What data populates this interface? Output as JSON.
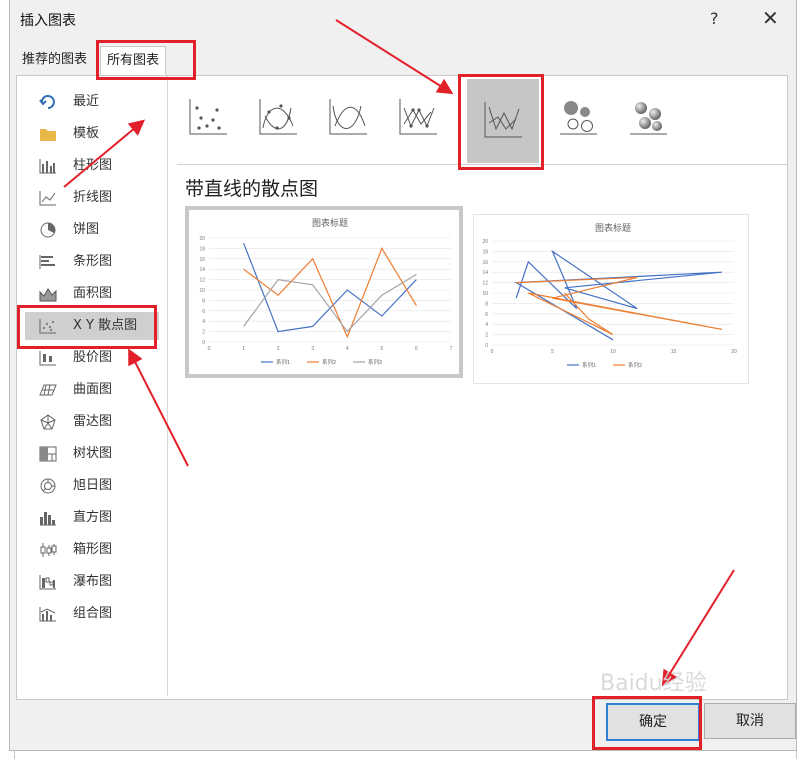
{
  "dialog": {
    "title": "插入图表",
    "help": "?",
    "close": "✕"
  },
  "tabs": [
    {
      "label": "推荐的图表"
    },
    {
      "label": "所有图表"
    }
  ],
  "sidebar": {
    "items": [
      {
        "label": "最近",
        "icon": "recent-icon"
      },
      {
        "label": "模板",
        "icon": "folder-icon"
      },
      {
        "label": "柱形图",
        "icon": "column-chart-icon"
      },
      {
        "label": "折线图",
        "icon": "line-chart-icon"
      },
      {
        "label": "饼图",
        "icon": "pie-chart-icon"
      },
      {
        "label": "条形图",
        "icon": "bar-chart-icon"
      },
      {
        "label": "面积图",
        "icon": "area-chart-icon"
      },
      {
        "label": "X Y 散点图",
        "icon": "scatter-chart-icon",
        "selected": true
      },
      {
        "label": "股价图",
        "icon": "stock-chart-icon"
      },
      {
        "label": "曲面图",
        "icon": "surface-chart-icon"
      },
      {
        "label": "雷达图",
        "icon": "radar-chart-icon"
      },
      {
        "label": "树状图",
        "icon": "treemap-icon"
      },
      {
        "label": "旭日图",
        "icon": "sunburst-icon"
      },
      {
        "label": "直方图",
        "icon": "histogram-icon"
      },
      {
        "label": "箱形图",
        "icon": "boxplot-icon"
      },
      {
        "label": "瀑布图",
        "icon": "waterfall-icon"
      },
      {
        "label": "组合图",
        "icon": "combo-icon"
      }
    ]
  },
  "subtypes": [
    {
      "icon": "scatter-icon"
    },
    {
      "icon": "scatter-smooth-lines-markers-icon"
    },
    {
      "icon": "scatter-smooth-lines-icon"
    },
    {
      "icon": "scatter-straight-lines-markers-icon"
    },
    {
      "icon": "scatter-straight-lines-icon",
      "selected": true
    },
    {
      "icon": "bubble-icon"
    },
    {
      "icon": "3d-bubble-icon"
    }
  ],
  "selected_type_title": "带直线的散点图",
  "preview_texts": {
    "chart_title": "图表标题",
    "series1": "系列1",
    "series2": "系列2",
    "series3": "系列3"
  },
  "buttons": {
    "ok": "确定",
    "cancel": "取消"
  },
  "watermark": "Baidu经验",
  "colors": {
    "series1": "#4472c4",
    "series2": "#ed7d31",
    "series3": "#a5a5a5",
    "highlight": "#e2202a"
  },
  "chart_data": [
    {
      "type": "scatter",
      "title": "图表标题",
      "xlim": [
        0,
        7
      ],
      "ylim": [
        0,
        20
      ],
      "x_ticks": [
        0,
        1,
        2,
        3,
        4,
        5,
        6,
        7
      ],
      "y_ticks": [
        0,
        2,
        4,
        6,
        8,
        10,
        12,
        14,
        16,
        18,
        20
      ],
      "legend": "bottom",
      "series": [
        {
          "name": "系列1",
          "points": [
            [
              1,
              19
            ],
            [
              2,
              2
            ],
            [
              3,
              3
            ],
            [
              4,
              10
            ],
            [
              5,
              5
            ],
            [
              6,
              12
            ]
          ]
        },
        {
          "name": "系列2",
          "points": [
            [
              1,
              14
            ],
            [
              2,
              9
            ],
            [
              3,
              16
            ],
            [
              4,
              1
            ],
            [
              5,
              18
            ],
            [
              6,
              7
            ]
          ]
        },
        {
          "name": "系列3",
          "points": [
            [
              1,
              3
            ],
            [
              2,
              12
            ],
            [
              3,
              11
            ],
            [
              4,
              2
            ],
            [
              5,
              9
            ],
            [
              6,
              13
            ]
          ]
        }
      ]
    },
    {
      "type": "scatter",
      "title": "图表标题",
      "xlim": [
        0,
        20
      ],
      "ylim": [
        0,
        20
      ],
      "x_ticks": [
        0,
        5,
        10,
        15,
        20
      ],
      "y_ticks": [
        0,
        2,
        4,
        6,
        8,
        10,
        12,
        14,
        16,
        18,
        20
      ],
      "legend": "bottom",
      "series": [
        {
          "name": "系列1",
          "points": [
            [
              2,
              9
            ],
            [
              3,
              16
            ],
            [
              7,
              7
            ],
            [
              5,
              18
            ],
            [
              12,
              7
            ],
            [
              6,
              11
            ],
            [
              19,
              14
            ],
            [
              2,
              12
            ],
            [
              10,
              1
            ]
          ]
        },
        {
          "name": "系列2",
          "points": [
            [
              2,
              12
            ],
            [
              12,
              13
            ],
            [
              5,
              9
            ],
            [
              19,
              3
            ],
            [
              3,
              10
            ],
            [
              10,
              2
            ],
            [
              8,
              5
            ],
            [
              6,
              10
            ]
          ]
        }
      ]
    }
  ]
}
